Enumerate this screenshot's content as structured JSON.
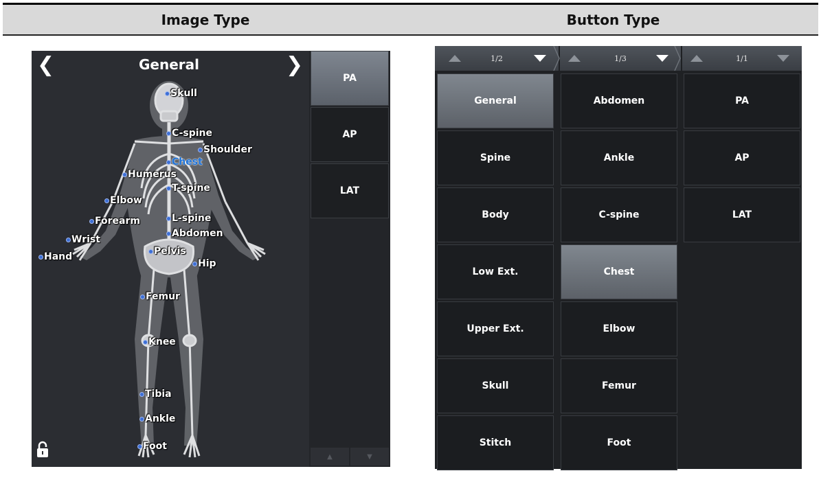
{
  "headers": {
    "left": "Image Type",
    "right": "Button Type"
  },
  "image_panel": {
    "title": "General",
    "prev_icon": "chevron-left-icon",
    "next_icon": "chevron-right-icon",
    "lock_icon": "lock-icon",
    "body_labels": [
      {
        "id": "skull",
        "label": "Skull"
      },
      {
        "id": "c-spine",
        "label": "C-spine"
      },
      {
        "id": "shoulder",
        "label": "Shoulder"
      },
      {
        "id": "chest",
        "label": "Chest",
        "active": true
      },
      {
        "id": "humerus",
        "label": "Humerus"
      },
      {
        "id": "t-spine",
        "label": "T-spine"
      },
      {
        "id": "elbow",
        "label": "Elbow"
      },
      {
        "id": "forearm",
        "label": "Forearm"
      },
      {
        "id": "l-spine",
        "label": "L-spine"
      },
      {
        "id": "abdomen",
        "label": "Abdomen"
      },
      {
        "id": "wrist",
        "label": "Wrist"
      },
      {
        "id": "pelvis",
        "label": "Pelvis"
      },
      {
        "id": "hand",
        "label": "Hand"
      },
      {
        "id": "hip",
        "label": "Hip"
      },
      {
        "id": "femur",
        "label": "Femur"
      },
      {
        "id": "knee",
        "label": "Knee"
      },
      {
        "id": "tibia",
        "label": "Tibia"
      },
      {
        "id": "ankle",
        "label": "Ankle"
      },
      {
        "id": "foot",
        "label": "Foot"
      }
    ],
    "views": [
      {
        "label": "PA",
        "selected": true
      },
      {
        "label": "AP",
        "selected": false
      },
      {
        "label": "LAT",
        "selected": false
      }
    ]
  },
  "button_panel": {
    "pagers": [
      {
        "page": "1/2"
      },
      {
        "page": "1/3"
      },
      {
        "page": "1/1"
      }
    ],
    "columns": [
      {
        "buttons": [
          {
            "label": "General",
            "selected": true
          },
          {
            "label": "Spine"
          },
          {
            "label": "Body"
          },
          {
            "label": "Low Ext."
          },
          {
            "label": "Upper Ext."
          },
          {
            "label": "Skull"
          },
          {
            "label": "Stitch"
          }
        ]
      },
      {
        "buttons": [
          {
            "label": "Abdomen"
          },
          {
            "label": "Ankle"
          },
          {
            "label": "C-spine"
          },
          {
            "label": "Chest",
            "selected": true
          },
          {
            "label": "Elbow"
          },
          {
            "label": "Femur"
          },
          {
            "label": "Foot"
          }
        ]
      },
      {
        "buttons": [
          {
            "label": "PA"
          },
          {
            "label": "AP"
          },
          {
            "label": "LAT"
          }
        ]
      }
    ]
  },
  "colors": {
    "accent_dot": "#3d6fd6",
    "active_label": "#1f73d8",
    "selected_button": "#6e747c",
    "panel_bg": "#2a2c31"
  }
}
